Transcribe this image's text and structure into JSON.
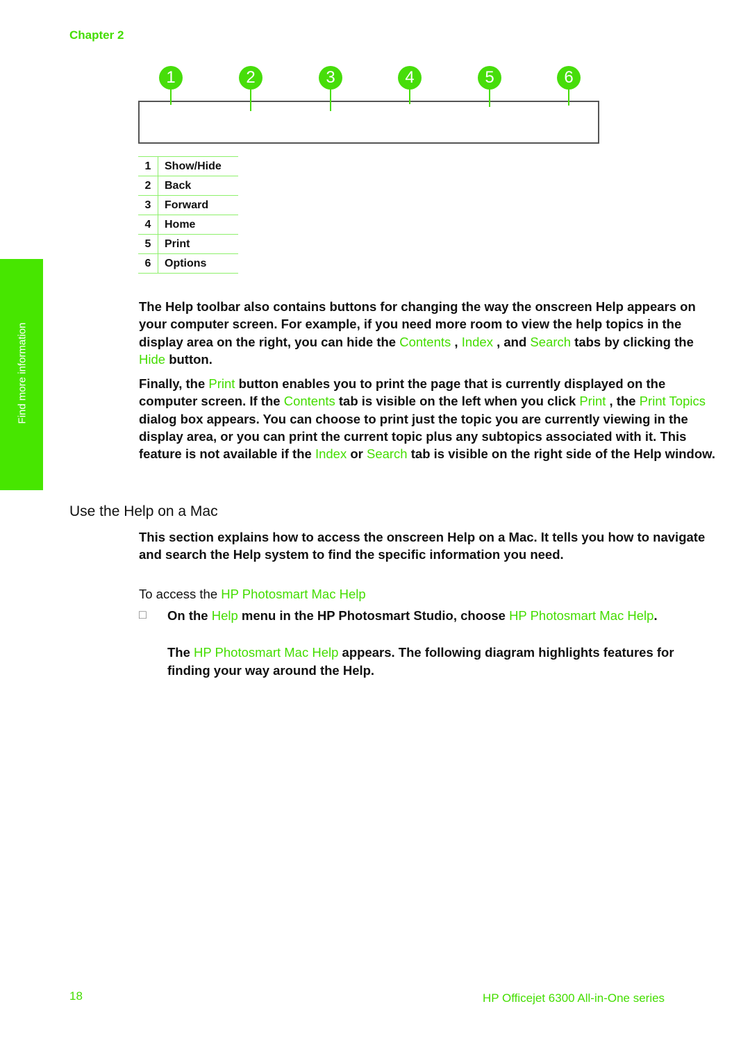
{
  "header": {
    "chapter": "Chapter 2"
  },
  "diagram": {
    "callouts": [
      "1",
      "2",
      "3",
      "4",
      "5",
      "6"
    ],
    "accent_color": "#47dd0a"
  },
  "legend_table": [
    {
      "num": "1",
      "label": "Show/Hide"
    },
    {
      "num": "2",
      "label": "Back"
    },
    {
      "num": "3",
      "label": "Forward"
    },
    {
      "num": "4",
      "label": "Home"
    },
    {
      "num": "5",
      "label": "Print"
    },
    {
      "num": "6",
      "label": "Options"
    }
  ],
  "sidebar": {
    "label": "Find more information"
  },
  "para1": {
    "t1": "The Help toolbar also contains buttons for changing the way the onscreen Help appears on your computer screen. For example, if you need more room to view the help topics in the display area on the right, you can hide the ",
    "l1": "Contents",
    "t2": " , ",
    "l2": "Index",
    "t3": " , and ",
    "l3": "Search",
    "t4": "  tabs by clicking the ",
    "l4": "Hide",
    "t5": "  button."
  },
  "para2": {
    "t1": "Finally, the ",
    "l1": "Print",
    "t2": "  button enables you to print the page that is currently displayed on the computer screen. If the ",
    "l2": "Contents",
    "t3": "  tab is visible on the left when you click ",
    "l3": "Print",
    "t4": " , the ",
    "l4": "Print Topics",
    "t5": "  dialog box appears. You can choose to print just the topic you are currently viewing in the display area, or you can print the current topic plus any subtopics associated with it. This feature is not available if the ",
    "l5": "Index",
    "t6": "  or ",
    "l6": "Search",
    "t7": "  tab is visible on the right side of the Help window."
  },
  "section": {
    "heading": "Use the Help on a Mac",
    "intro": "This section explains how to access the onscreen Help on a Mac. It tells you how to navigate and search the Help system to find the specific information you need."
  },
  "procedure": {
    "title_prefix": "To access the ",
    "title_link": "HP Photosmart Mac Help",
    "bullet": "□",
    "step1_t1": "On the ",
    "step1_l1": "Help",
    "step1_t2": "  menu in the HP Photosmart Studio, choose ",
    "step1_l2": "HP Photosmart Mac Help",
    "step1_t3": ".",
    "step2_t1": "The ",
    "step2_l1": "HP Photosmart Mac Help",
    "step2_t2": "  appears. The following diagram highlights features for finding your way around the Help."
  },
  "footer": {
    "page_number": "18",
    "product": "HP Officejet 6300 All-in-One series"
  }
}
